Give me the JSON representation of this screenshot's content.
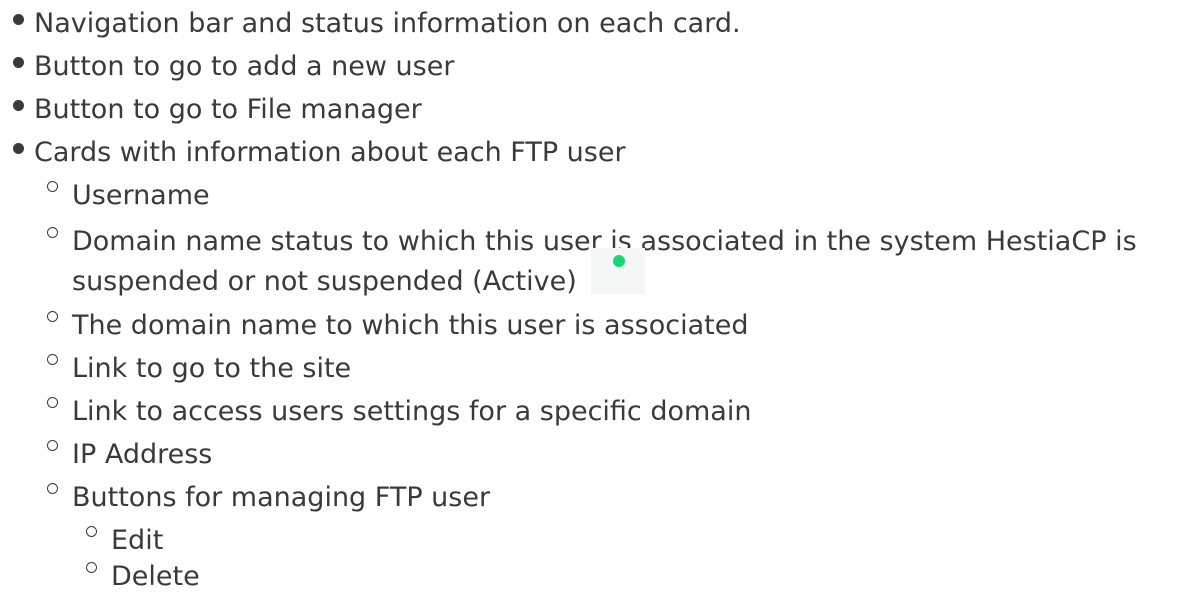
{
  "list": {
    "items": [
      "Navigation bar and status information on each card.",
      "Button to go to add a new user",
      "Button to go to File manager",
      "Cards with information about each FTP user"
    ],
    "card_items": {
      "username": "Username",
      "domain_status_line1": "Domain name status to which this user is associated in the system HestiaCP is",
      "domain_status_line2": "suspended or not suspended (Active)",
      "domain_name": "The domain name to which this user is associated",
      "site_link": "Link to go to the site",
      "settings_link": "Link to access users settings for a specific domain",
      "ip_address": "IP Address",
      "buttons": "Buttons for managing FTP user"
    },
    "button_items": {
      "edit": "Edit",
      "delete": "Delete"
    }
  },
  "status": {
    "active_color": "#1ad573",
    "icon": "status-dot-icon"
  }
}
